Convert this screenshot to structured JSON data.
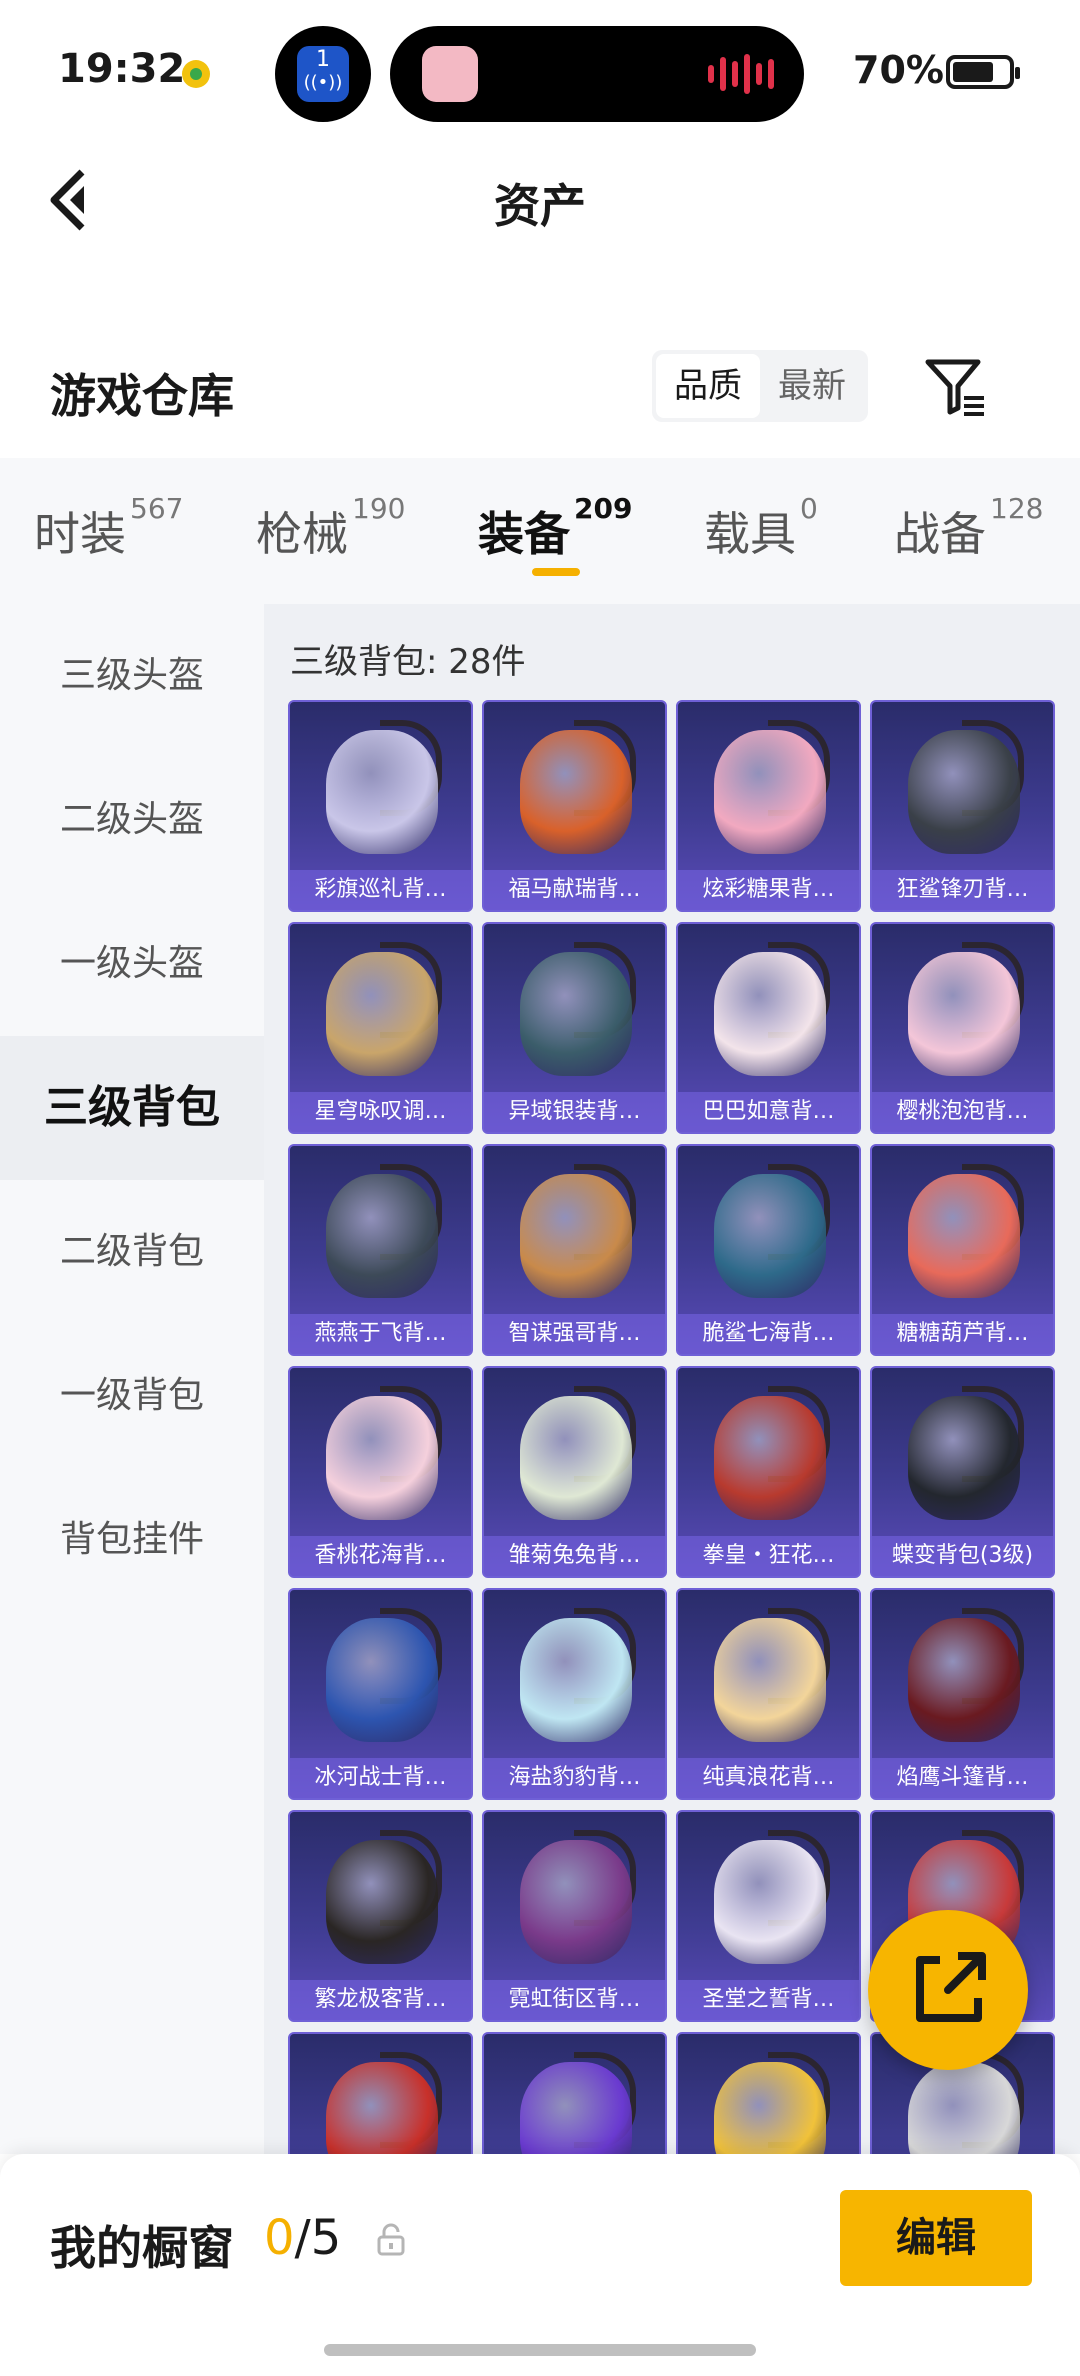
{
  "status_bar": {
    "time": "19:32",
    "notif_number": "1",
    "battery": "70%"
  },
  "header": {
    "title": "资产"
  },
  "warehouse": {
    "title": "游戏仓库",
    "sort_options": [
      "品质",
      "最新"
    ],
    "sort_active": "品质"
  },
  "tabs": [
    {
      "label": "时装",
      "count": "567"
    },
    {
      "label": "枪械",
      "count": "190"
    },
    {
      "label": "装备",
      "count": "209",
      "active": true
    },
    {
      "label": "载具",
      "count": "0"
    },
    {
      "label": "战备",
      "count": "128"
    }
  ],
  "sidebar": {
    "items": [
      "三级头盔",
      "二级头盔",
      "一级头盔",
      "三级背包",
      "二级背包",
      "一级背包",
      "背包挂件"
    ],
    "active": "三级背包"
  },
  "content": {
    "heading": "三级背包: 28件",
    "items": [
      {
        "name": "彩旗巡礼背…",
        "color": "#c9c6e8"
      },
      {
        "name": "福马献瑞背…",
        "color": "#d9612a"
      },
      {
        "name": "炫彩糖果背…",
        "color": "#f2a9c0"
      },
      {
        "name": "狂鲨锋刃背…",
        "color": "#3a4048"
      },
      {
        "name": "星穹咏叹调…",
        "color": "#c9a56a"
      },
      {
        "name": "异域银装背…",
        "color": "#3b5d6a"
      },
      {
        "name": "巴巴如意背…",
        "color": "#f3e4ea"
      },
      {
        "name": "樱桃泡泡背…",
        "color": "#f4c6d8"
      },
      {
        "name": "燕燕于飞背…",
        "color": "#3d4a58"
      },
      {
        "name": "智谋强哥背…",
        "color": "#c98a4a"
      },
      {
        "name": "脆鲨七海背…",
        "color": "#2e6a8a"
      },
      {
        "name": "糖糖葫芦背…",
        "color": "#e86a5a"
      },
      {
        "name": "香桃花海背…",
        "color": "#f5d0dc"
      },
      {
        "name": "雏菊兔兔背…",
        "color": "#dfe8d4"
      },
      {
        "name": "拳皇・狂花…",
        "color": "#b83a2e"
      },
      {
        "name": "蝶变背包(3级)",
        "color": "#23272e"
      },
      {
        "name": "冰河战士背…",
        "color": "#2d55b0"
      },
      {
        "name": "海盐豹豹背…",
        "color": "#bfe6f2"
      },
      {
        "name": "纯真浪花背…",
        "color": "#f3d59a"
      },
      {
        "name": "焰鹰斗篷背…",
        "color": "#6a1a20"
      },
      {
        "name": "繁龙极客背…",
        "color": "#2a2624"
      },
      {
        "name": "霓虹街区背…",
        "color": "#7a3a8a"
      },
      {
        "name": "圣堂之誓背…",
        "color": "#e9e4f2"
      },
      {
        "name": "",
        "color": "#c83a3a"
      },
      {
        "name": "",
        "color": "#c8302a"
      },
      {
        "name": "",
        "color": "#6a3ad0"
      },
      {
        "name": "",
        "color": "#f1c23a"
      },
      {
        "name": "",
        "color": "#d8d8d8"
      }
    ]
  },
  "bottom": {
    "showcase_title": "我的橱窗",
    "showcase_current": "0",
    "showcase_total": "/5",
    "edit_label": "编辑"
  }
}
